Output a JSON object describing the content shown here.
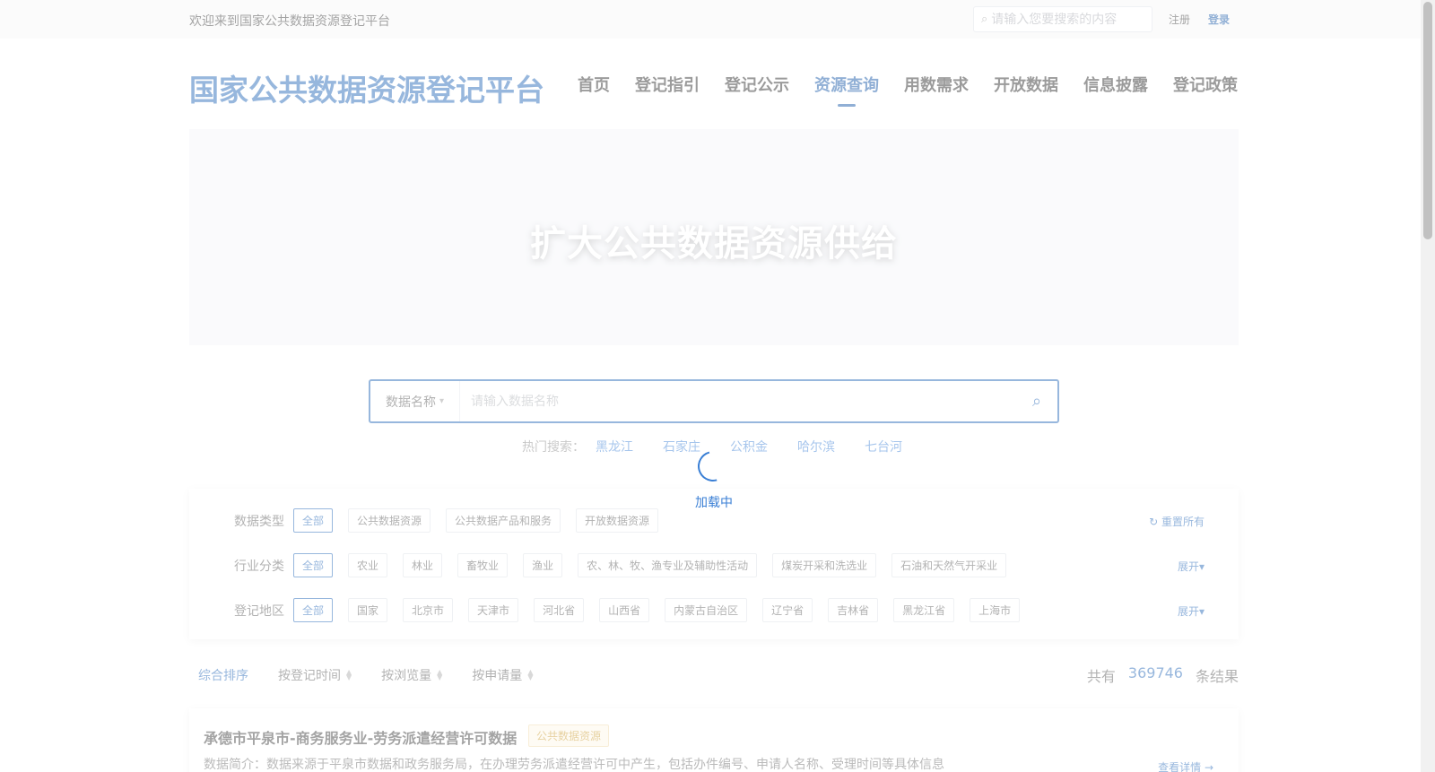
{
  "topbar": {
    "welcome": "欢迎来到国家公共数据资源登记平台",
    "search_placeholder": "请输入您要搜索的内容",
    "register": "注册",
    "login": "登录"
  },
  "header": {
    "logo": "国家公共数据资源登记平台",
    "nav": [
      {
        "label": "首页"
      },
      {
        "label": "登记指引"
      },
      {
        "label": "登记公示"
      },
      {
        "label": "资源查询",
        "active": true
      },
      {
        "label": "用数需求"
      },
      {
        "label": "开放数据"
      },
      {
        "label": "信息披露"
      },
      {
        "label": "登记政策"
      }
    ]
  },
  "banner": {
    "title": "扩大公共数据资源供给"
  },
  "search": {
    "select_label": "数据名称",
    "placeholder": "请输入数据名称",
    "hot_label": "热门搜索：",
    "hot_keywords": [
      "黑龙江",
      "石家庄",
      "公积金",
      "哈尔滨",
      "七台河"
    ]
  },
  "loading": {
    "text": "加载中"
  },
  "filters": {
    "reset_label": "重置所有",
    "expand_label": "展开",
    "data_type": {
      "label": "数据类型",
      "options": [
        "全部",
        "公共数据资源",
        "公共数据产品和服务",
        "开放数据资源"
      ]
    },
    "industry": {
      "label": "行业分类",
      "options": [
        "全部",
        "农业",
        "林业",
        "畜牧业",
        "渔业",
        "农、林、牧、渔专业及辅助性活动",
        "煤炭开采和洗选业",
        "石油和天然气开采业"
      ]
    },
    "region": {
      "label": "登记地区",
      "options": [
        "全部",
        "国家",
        "北京市",
        "天津市",
        "河北省",
        "山西省",
        "内蒙古自治区",
        "辽宁省",
        "吉林省",
        "黑龙江省",
        "上海市"
      ]
    }
  },
  "sort": {
    "options": [
      "综合排序",
      "按登记时间",
      "按浏览量",
      "按申请量"
    ],
    "total_prefix": "共有",
    "total_count": "369746",
    "total_suffix": "条结果"
  },
  "results": [
    {
      "title": "承德市平泉市-商务服务业-劳务派遣经营许可数据",
      "tag": "公共数据资源",
      "desc": "数据简介：数据来源于平泉市数据和政务服务局，在办理劳务派遣经营许可中产生，包括办件编号、申请人名称、受理时间等具体信息",
      "more": "查看详情"
    }
  ],
  "colors": {
    "primary": "#1a5fb4",
    "accent": "#0b4fa2",
    "tag_gold": "#c99a2e"
  }
}
